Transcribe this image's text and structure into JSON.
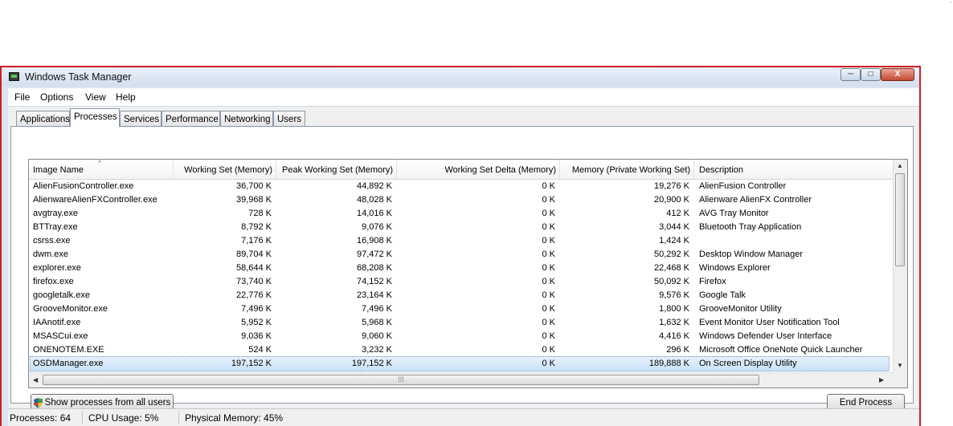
{
  "window": {
    "title": "Windows Task Manager",
    "controls": {
      "minimize": "─",
      "maximize": "□",
      "close": "X"
    }
  },
  "menu": [
    "File",
    "Options",
    "View",
    "Help"
  ],
  "tabs": [
    "Applications",
    "Processes",
    "Services",
    "Performance",
    "Networking",
    "Users"
  ],
  "active_tab": "Processes",
  "columns": [
    "Image Name",
    "Working Set (Memory)",
    "Peak Working Set (Memory)",
    "Working Set Delta (Memory)",
    "Memory (Private Working Set)",
    "Description"
  ],
  "sort_indicator": "˄",
  "processes": [
    {
      "name": "AlienFusionController.exe",
      "ws": "36,700 K",
      "peak": "44,892 K",
      "delta": "0 K",
      "private": "19,276 K",
      "desc": "AlienFusion Controller"
    },
    {
      "name": "AlienwareAlienFXController.exe",
      "ws": "39,968 K",
      "peak": "48,028 K",
      "delta": "0 K",
      "private": "20,900 K",
      "desc": "Alienware AlienFX Controller"
    },
    {
      "name": "avgtray.exe",
      "ws": "728 K",
      "peak": "14,016 K",
      "delta": "0 K",
      "private": "412 K",
      "desc": "AVG Tray Monitor"
    },
    {
      "name": "BTTray.exe",
      "ws": "8,792 K",
      "peak": "9,076 K",
      "delta": "0 K",
      "private": "3,044 K",
      "desc": "Bluetooth Tray Application"
    },
    {
      "name": "csrss.exe",
      "ws": "7,176 K",
      "peak": "16,908 K",
      "delta": "0 K",
      "private": "1,424 K",
      "desc": ""
    },
    {
      "name": "dwm.exe",
      "ws": "89,704 K",
      "peak": "97,472 K",
      "delta": "0 K",
      "private": "50,292 K",
      "desc": "Desktop Window Manager"
    },
    {
      "name": "explorer.exe",
      "ws": "58,644 K",
      "peak": "68,208 K",
      "delta": "0 K",
      "private": "22,468 K",
      "desc": "Windows Explorer"
    },
    {
      "name": "firefox.exe",
      "ws": "73,740 K",
      "peak": "74,152 K",
      "delta": "0 K",
      "private": "50,092 K",
      "desc": "Firefox"
    },
    {
      "name": "googletalk.exe",
      "ws": "22,776 K",
      "peak": "23,164 K",
      "delta": "0 K",
      "private": "9,576 K",
      "desc": "Google Talk"
    },
    {
      "name": "GrooveMonitor.exe",
      "ws": "7,496 K",
      "peak": "7,496 K",
      "delta": "0 K",
      "private": "1,800 K",
      "desc": "GrooveMonitor Utility"
    },
    {
      "name": "IAAnotif.exe",
      "ws": "5,952 K",
      "peak": "5,968 K",
      "delta": "0 K",
      "private": "1,632 K",
      "desc": "Event Monitor User Notification Tool"
    },
    {
      "name": "MSASCui.exe",
      "ws": "9,036 K",
      "peak": "9,060 K",
      "delta": "0 K",
      "private": "4,416 K",
      "desc": "Windows Defender User Interface"
    },
    {
      "name": "ONENOTEM.EXE",
      "ws": "524 K",
      "peak": "3,232 K",
      "delta": "0 K",
      "private": "296 K",
      "desc": "Microsoft Office OneNote Quick Launcher"
    },
    {
      "name": "OSDManager.exe",
      "ws": "197,152 K",
      "peak": "197,152 K",
      "delta": "0 K",
      "private": "189,888 K",
      "desc": "On Screen Display Utility",
      "selected": true
    }
  ],
  "buttons": {
    "show_all": "Show processes from all users",
    "end_process": "End Process"
  },
  "status": {
    "processes": "Processes: 64",
    "cpu": "CPU Usage: 5%",
    "memory": "Physical Memory: 45%"
  },
  "icons": {
    "app": "task-manager-icon",
    "shield": "uac-shield-icon"
  }
}
